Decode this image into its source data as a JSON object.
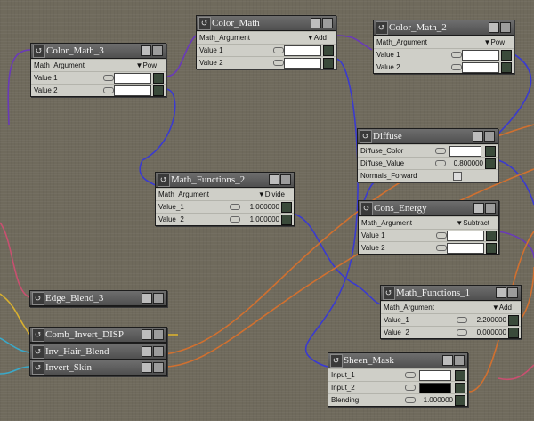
{
  "nodes": {
    "color_math_3": {
      "title": "Color_Math_3",
      "arg_label": "Math_Argument",
      "arg_value": "Pow",
      "v1": "Value 1",
      "v2": "Value 2"
    },
    "color_math": {
      "title": "Color_Math",
      "arg_label": "Math_Argument",
      "arg_value": "Add",
      "v1": "Value 1",
      "v2": "Value 2"
    },
    "color_math_2": {
      "title": "Color_Math_2",
      "arg_label": "Math_Argument",
      "arg_value": "Pow",
      "v1": "Value 1",
      "v2": "Value 2"
    },
    "math_functions_2": {
      "title": "Math_Functions_2",
      "arg_label": "Math_Argument",
      "arg_value": "Divide",
      "v1": "Value_1",
      "v1_val": "1.000000",
      "v2": "Value_2",
      "v2_val": "1.000000"
    },
    "diffuse": {
      "title": "Diffuse",
      "r1": "Diffuse_Color",
      "r2": "Diffuse_Value",
      "r2_val": "0.800000",
      "r3": "Normals_Forward"
    },
    "cons_energy": {
      "title": "Cons_Energy",
      "arg_label": "Math_Argument",
      "arg_value": "Subtract",
      "v1": "Value 1",
      "v2": "Value 2"
    },
    "math_functions_1": {
      "title": "Math_Functions_1",
      "arg_label": "Math_Argument",
      "arg_value": "Add",
      "v1": "Value_1",
      "v1_val": "2.200000",
      "v2": "Value_2",
      "v2_val": "0.000000"
    },
    "sheen_mask": {
      "title": "Sheen_Mask",
      "r1": "Input_1",
      "r2": "Input_2",
      "r3": "Blending",
      "r3_val": "1.000000"
    },
    "edge_blend_3": {
      "title": "Edge_Blend_3"
    },
    "comb_invert_disp": {
      "title": "Comb_Invert_DISP"
    },
    "inv_hair_blend": {
      "title": "Inv_Hair_Blend"
    },
    "invert_skin": {
      "title": "Invert_Skin"
    }
  },
  "colors": {
    "canvas": "#6f6a5c",
    "wire_blue": "#3a3ad0",
    "wire_purple": "#6a3ab8",
    "wire_orange": "#d07030",
    "wire_yellow": "#d8b030",
    "wire_teal": "#3aa8c8",
    "wire_pink": "#c85070"
  }
}
